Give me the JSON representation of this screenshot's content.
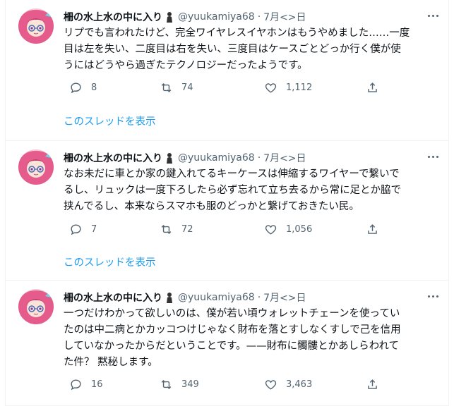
{
  "tweets": [
    {
      "name": "柵の水上水の中に入り",
      "handle": "@yuukamiya68",
      "separator": "·",
      "time": "7月<>日",
      "text": "リプでも言われたけど、完全ワイヤレスイヤホンはもうやめました……一度\n目は左を失い、二度目は右を失い、三度目はケースごとどっか行く僕が使\nうにはどうやら過ぎたテクノロジーだったようです。",
      "replies": "8",
      "retweets": "74",
      "likes": "1,112",
      "thread_link": "このスレッドを表示"
    },
    {
      "name": "柵の水上水の中に入り",
      "handle": "@yuukamiya68",
      "separator": "·",
      "time": "7月<>日",
      "text": "なお未だに車とか家の鍵入れてるキーケースは伸縮するワイヤーで繋いで\nるし、リュックは一度下ろしたら必ず忘れて立ち去るから常に足とか脇で\n挟んでるし、本来ならスマホも服のどっかと繋げておきたい民。",
      "replies": "7",
      "retweets": "72",
      "likes": "1,056",
      "thread_link": "このスレッドを表示"
    },
    {
      "name": "柵の水上水の中に入り",
      "handle": "@yuukamiya68",
      "separator": "·",
      "time": "7月<>日",
      "text": "一つだけわかって欲しいのは、僕が若い頃ウォレットチェーンを使ってい\nたのは中二病とかカッコつけじゃなく財布を落とすしなくすしで己を信用\nしていなかったからだということです。——財布に髑髏とかあしらわれて\nた件？ 黙秘します。",
      "replies": "16",
      "retweets": "349",
      "likes": "3,463"
    }
  ],
  "icons": {
    "reply": "speech-bubble",
    "retweet": "retweet-arrows",
    "like": "heart-outline",
    "share": "upload-arrow",
    "more": "three-dots",
    "badge": "person-silhouette"
  },
  "colors": {
    "link": "#1d9bf0",
    "secondary_text": "#536471",
    "border": "#eff3f4"
  }
}
